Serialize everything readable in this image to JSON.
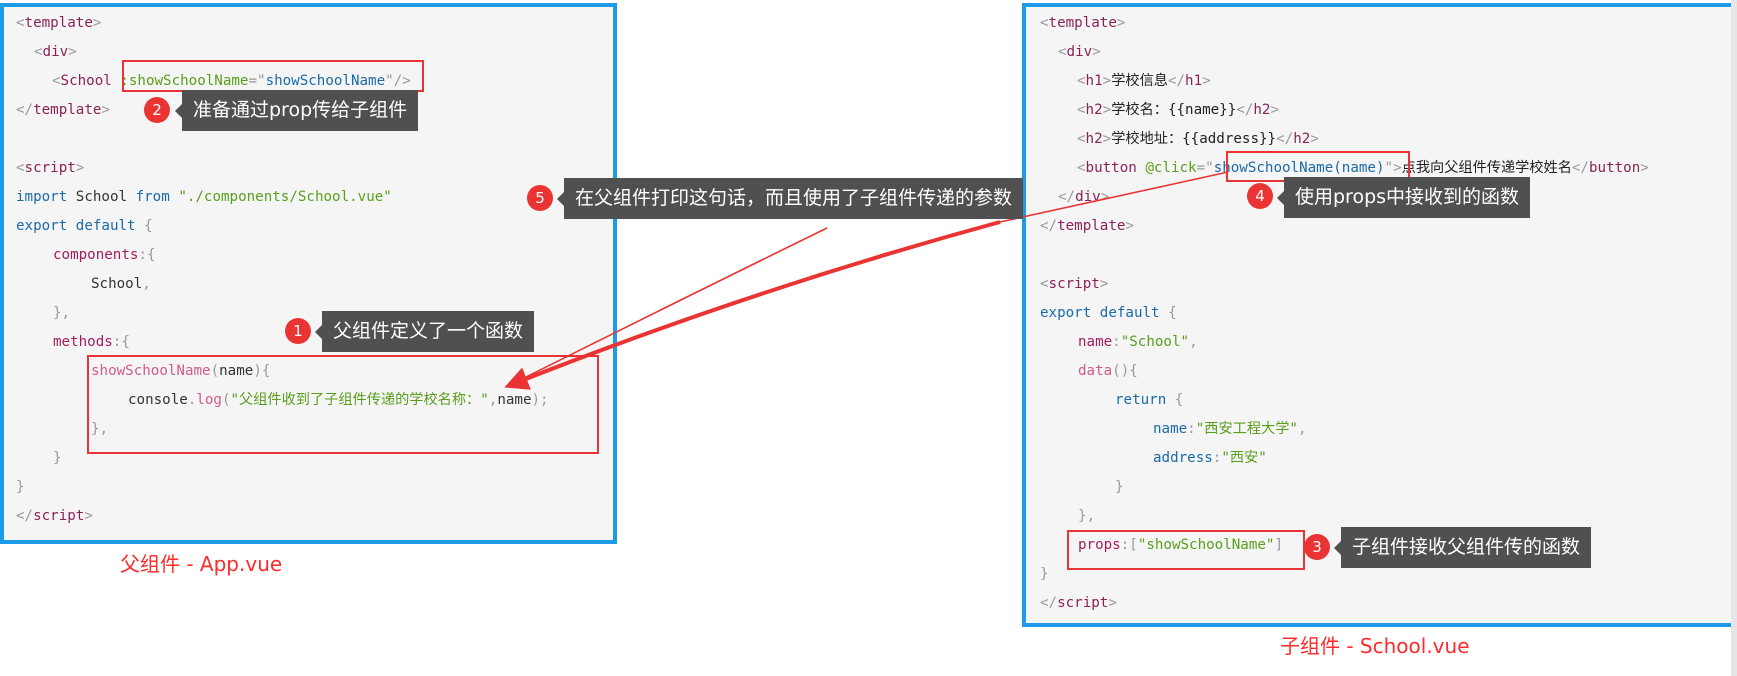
{
  "parent": {
    "caption": "父组件 - App.vue",
    "code": {
      "l1_tag": "template",
      "l2_tag": "div",
      "l3_tag": "School",
      "l3_attr": ":showSchoolName",
      "l3_value": "showSchoolName",
      "l4_tag": "template",
      "l6_tag": "script",
      "l7_import": "import",
      "l7_name": "School",
      "l7_from": "from",
      "l7_path": "\"./components/School.vue\"",
      "l8_export": "export",
      "l8_default": "default",
      "l9_prop": "components",
      "l10_name": "School",
      "l12_prop": "methods",
      "l13_fn": "showSchoolName",
      "l13_param": "name",
      "l14_console": "console",
      "l14_log": "log",
      "l14_str": "\"父组件收到了子组件传递的学校名称：\"",
      "l14_arg": "name",
      "l18_tag": "script"
    }
  },
  "child": {
    "caption": "子组件 - School.vue",
    "code": {
      "l1_tag": "template",
      "l2_tag": "div",
      "l3_tag": "h1",
      "l3_text": "学校信息",
      "l4_tag": "h2",
      "l4_text": "学校名：{{name}}",
      "l5_tag": "h2",
      "l5_text": "学校地址：{{address}}",
      "l6_tag": "button",
      "l6_attr": "@click",
      "l6_value": "showSchoolName(name)",
      "l6_text": "点我向父组件传递学校姓名",
      "l7_tag": "div",
      "l8_tag": "template",
      "l10_tag": "script",
      "l11_export": "export",
      "l11_default": "default",
      "l12_prop": "name",
      "l12_str": "\"School\"",
      "l13_fn": "data",
      "l14_return": "return",
      "l15_prop": "name",
      "l15_str": "\"西安工程大学\"",
      "l16_prop": "address",
      "l16_str": "\"西安\"",
      "l19_prop": "props",
      "l19_str": "\"showSchoolName\"",
      "l21_tag": "script"
    }
  },
  "annotations": [
    {
      "number": "1",
      "text": "父组件定义了一个函数"
    },
    {
      "number": "2",
      "text": "准备通过prop传给子组件"
    },
    {
      "number": "3",
      "text": "子组件接收父组件传的函数"
    },
    {
      "number": "4",
      "text": "使用props中接收到的函数"
    },
    {
      "number": "5",
      "text": "在父组件打印这句话，而且使用了子组件传递的参数"
    }
  ],
  "colors": {
    "panel_border": "#1e9be8",
    "highlight": "#ea3434",
    "callout_bg": "#505050",
    "caption": "#ff2a2a"
  }
}
